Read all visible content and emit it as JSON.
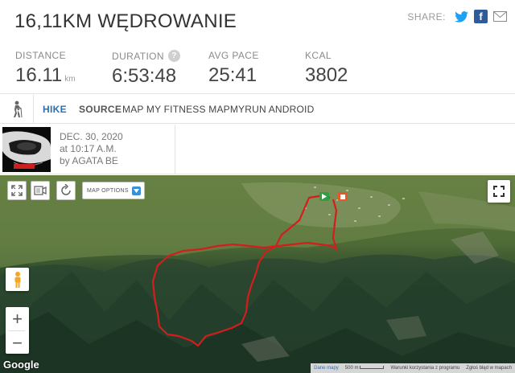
{
  "header": {
    "title": "16,11KM WĘDROWANIE",
    "share_label": "SHARE:",
    "share_icons": [
      "twitter-icon",
      "facebook-icon",
      "email-icon"
    ],
    "facebook_glyph": "f"
  },
  "stats": {
    "distance": {
      "label": "DISTANCE",
      "value": "16.11",
      "unit": "km"
    },
    "duration": {
      "label": "DURATION",
      "value": "6:53:48",
      "help": "?"
    },
    "avg_pace": {
      "label": "AVG PACE",
      "value": "25:41"
    },
    "kcal": {
      "label": "KCAL",
      "value": "3802"
    }
  },
  "activity": {
    "type": "HIKE",
    "source_label": "SOURCE",
    "source_value": "MAP MY FITNESS MAPMYRUN ANDROID"
  },
  "user": {
    "date": "DEC. 30, 2020",
    "time": "at 10:17 A.M.",
    "by": "by AGATA BE"
  },
  "map": {
    "options_label": "MAP OPTIONS",
    "google": "Google",
    "attribution": {
      "data": "Dane mapy",
      "scale": "500 m",
      "terms": "Warunki korzystania z programu",
      "report": "Zgłoś błąd w mapach"
    },
    "zoom_in": "+",
    "zoom_out": "−",
    "route_color": "#d41d1d",
    "start_color": "#2ea043",
    "finish_color": "#e8562a"
  },
  "colors": {
    "accent": "#2b6fb5",
    "twitter": "#1da1f2",
    "facebook": "#2f5b9a"
  }
}
